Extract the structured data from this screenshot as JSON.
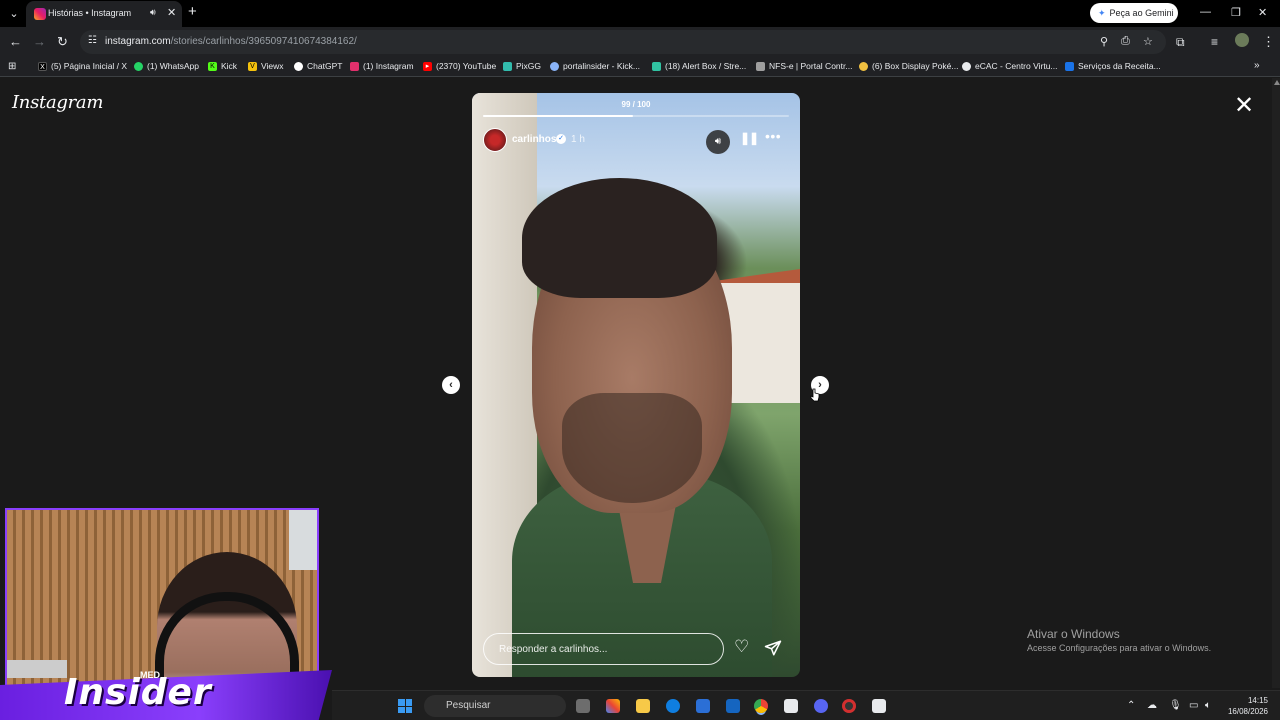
{
  "browser": {
    "tab_title": "Histórias • Instagram",
    "url_host": "instagram.com",
    "url_path": "/stories/carlinhos/3965097410674384162/",
    "gemini_label": "Peça ao Gemini",
    "bookmarks": [
      {
        "label": "(5) Página Inicial / X",
        "icon": "x-icon",
        "color": "#000000"
      },
      {
        "label": "(1) WhatsApp",
        "icon": "whatsapp-icon",
        "color": "#25d366"
      },
      {
        "label": "Kick",
        "icon": "kick-icon",
        "color": "#53fc18"
      },
      {
        "label": "Viewx",
        "icon": "viewx-icon",
        "color": "#f4c20d"
      },
      {
        "label": "ChatGPT",
        "icon": "chatgpt-icon",
        "color": "#ffffff"
      },
      {
        "label": "(1) Instagram",
        "icon": "instagram-icon",
        "color": "#e1306c"
      },
      {
        "label": "(2370) YouTube",
        "icon": "youtube-icon",
        "color": "#ff0000"
      },
      {
        "label": "PixGG",
        "icon": "pixgg-icon",
        "color": "#32bcad"
      },
      {
        "label": "portalinsider - Kick...",
        "icon": "portalinsider-icon",
        "color": "#8ab4f8"
      },
      {
        "label": "(18) Alert Box / Stre...",
        "icon": "streamlabs-icon",
        "color": "#31c3a2"
      },
      {
        "label": "NFS-e | Portal Contr...",
        "icon": "nfse-icon",
        "color": "#9e9e9e"
      },
      {
        "label": "(6) Box Display Poké...",
        "icon": "pokemon-icon",
        "color": "#f0c040"
      },
      {
        "label": "eCAC - Centro Virtu...",
        "icon": "ecac-icon",
        "color": "#e8eaed"
      },
      {
        "label": "Serviços da Receita...",
        "icon": "receita-icon",
        "color": "#1a73e8"
      }
    ]
  },
  "instagram": {
    "logo": "Instagram",
    "story": {
      "counter": "99 / 100",
      "progress": 0.49,
      "username": "carlinhos",
      "time": "1 h",
      "reply_placeholder": "Responder a carlinhos..."
    }
  },
  "windows": {
    "activation_title": "Ativar o Windows",
    "activation_subtitle": "Acesse Configurações para ativar o Windows.",
    "search_placeholder": "Pesquisar",
    "time": "14:15",
    "date": "16/08/2026"
  },
  "stream_overlay": {
    "brand": "Insider",
    "tag": "MED"
  },
  "colors": {
    "accent_purple": "#8a3ffc",
    "chrome_dark": "#202124"
  }
}
